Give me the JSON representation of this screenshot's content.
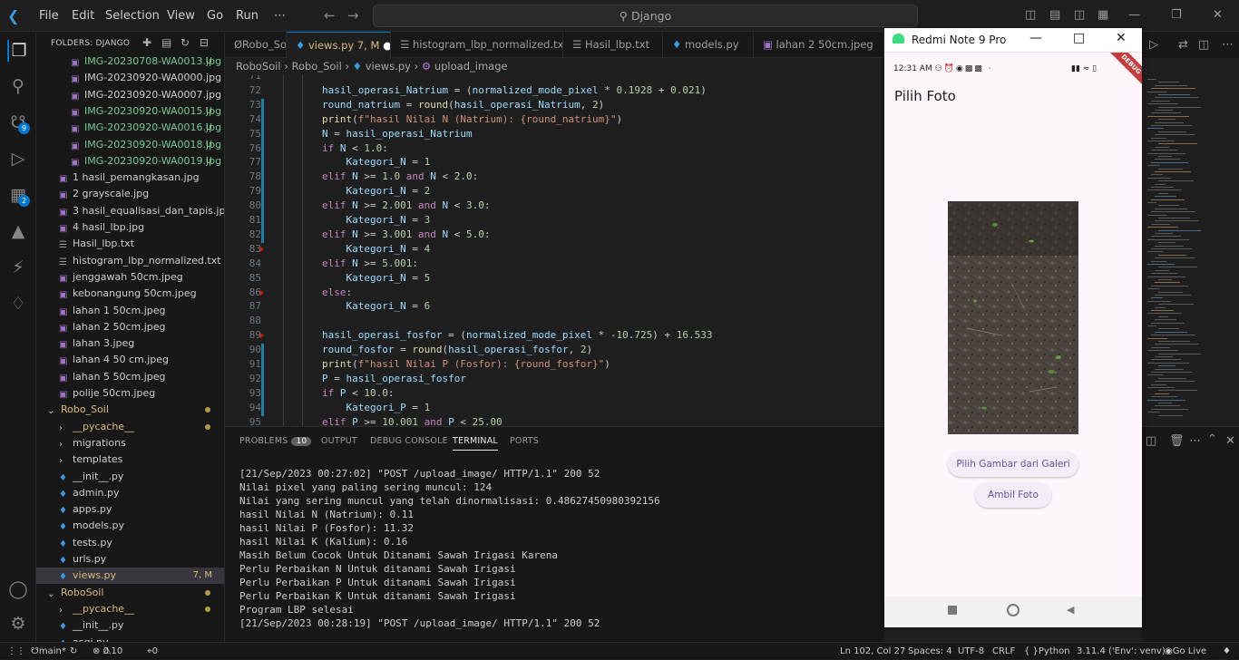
{
  "title_bar": {
    "menus": [
      "File",
      "Edit",
      "Selection",
      "View",
      "Go",
      "Run",
      "⋯"
    ],
    "search": "Django"
  },
  "activity_badges": {
    "source_control": "9",
    "extensions": "2"
  },
  "explorer": {
    "header": "FOLDERS: DJANGO",
    "items": [
      {
        "label": "IMG-20230708-WA0013.jpg",
        "status": "U",
        "indent": 2,
        "type": "image",
        "color": "#73c991"
      },
      {
        "label": "IMG-20230920-WA0000.jpg",
        "status": "",
        "indent": 2,
        "type": "image",
        "color": "#cccccc"
      },
      {
        "label": "IMG-20230920-WA0007.jpg",
        "status": "",
        "indent": 2,
        "type": "image",
        "color": "#cccccc"
      },
      {
        "label": "IMG-20230920-WA0015.jpg",
        "status": "U",
        "indent": 2,
        "type": "image",
        "color": "#73c991"
      },
      {
        "label": "IMG-20230920-WA0016.jpg",
        "status": "U",
        "indent": 2,
        "type": "image",
        "color": "#73c991"
      },
      {
        "label": "IMG-20230920-WA0018.jpg",
        "status": "U",
        "indent": 2,
        "type": "image",
        "color": "#73c991"
      },
      {
        "label": "IMG-20230920-WA0019.jpg",
        "status": "U",
        "indent": 2,
        "type": "image",
        "color": "#73c991"
      },
      {
        "label": "1 hasil_pemangkasan.jpg",
        "status": "",
        "indent": 1,
        "type": "image",
        "color": "#cccccc"
      },
      {
        "label": "2 grayscale.jpg",
        "status": "",
        "indent": 1,
        "type": "image",
        "color": "#cccccc"
      },
      {
        "label": "3 hasil_equalisasi_dan_tapis.jpg",
        "status": "",
        "indent": 1,
        "type": "image",
        "color": "#cccccc"
      },
      {
        "label": "4 hasil_lbp.jpg",
        "status": "",
        "indent": 1,
        "type": "image",
        "color": "#cccccc"
      },
      {
        "label": "Hasil_lbp.txt",
        "status": "",
        "indent": 1,
        "type": "text",
        "color": "#cccccc"
      },
      {
        "label": "histogram_lbp_normalized.txt",
        "status": "",
        "indent": 1,
        "type": "text",
        "color": "#cccccc"
      },
      {
        "label": "jenggawah 50cm.jpeg",
        "status": "",
        "indent": 1,
        "type": "image",
        "color": "#cccccc"
      },
      {
        "label": "kebonangung 50cm.jpeg",
        "status": "",
        "indent": 1,
        "type": "image",
        "color": "#cccccc"
      },
      {
        "label": "lahan 1 50cm.jpeg",
        "status": "",
        "indent": 1,
        "type": "image",
        "color": "#cccccc"
      },
      {
        "label": "lahan 2 50cm.jpeg",
        "status": "",
        "indent": 1,
        "type": "image",
        "color": "#cccccc"
      },
      {
        "label": "lahan 3.jpeg",
        "status": "",
        "indent": 1,
        "type": "image",
        "color": "#cccccc"
      },
      {
        "label": "lahan 4 50 cm.jpeg",
        "status": "",
        "indent": 1,
        "type": "image",
        "color": "#cccccc"
      },
      {
        "label": "lahan 5 50cm.jpeg",
        "status": "",
        "indent": 1,
        "type": "image",
        "color": "#cccccc"
      },
      {
        "label": "polije 50cm.jpeg",
        "status": "",
        "indent": 1,
        "type": "image",
        "color": "#cccccc"
      },
      {
        "label": "Robo_Soil",
        "status": "dot",
        "indent": 0,
        "type": "folder-open",
        "color": "#d7ba7d"
      },
      {
        "label": "__pycache__",
        "status": "dot",
        "indent": 1,
        "type": "folder",
        "color": "#d7ba7d"
      },
      {
        "label": "migrations",
        "status": "",
        "indent": 1,
        "type": "folder",
        "color": "#cccccc"
      },
      {
        "label": "templates",
        "status": "",
        "indent": 1,
        "type": "folder",
        "color": "#cccccc"
      },
      {
        "label": "__init__.py",
        "status": "",
        "indent": 1,
        "type": "python",
        "color": "#cccccc"
      },
      {
        "label": "admin.py",
        "status": "",
        "indent": 1,
        "type": "python",
        "color": "#cccccc"
      },
      {
        "label": "apps.py",
        "status": "",
        "indent": 1,
        "type": "python",
        "color": "#cccccc"
      },
      {
        "label": "models.py",
        "status": "",
        "indent": 1,
        "type": "python",
        "color": "#cccccc"
      },
      {
        "label": "tests.py",
        "status": "",
        "indent": 1,
        "type": "python",
        "color": "#cccccc"
      },
      {
        "label": "urls.py",
        "status": "",
        "indent": 1,
        "type": "python",
        "color": "#cccccc"
      },
      {
        "label": "views.py",
        "status": "7, M",
        "indent": 1,
        "type": "python",
        "color": "#d7ba7d"
      },
      {
        "label": "RoboSoil",
        "status": "dot",
        "indent": 0,
        "type": "folder-open",
        "color": "#d7ba7d"
      },
      {
        "label": "__pycache__",
        "status": "dot",
        "indent": 1,
        "type": "folder",
        "color": "#d7ba7d"
      },
      {
        "label": "__init__.py",
        "status": "",
        "indent": 1,
        "type": "python",
        "color": "#cccccc"
      },
      {
        "label": "asgi.py",
        "status": "",
        "indent": 1,
        "type": "python",
        "color": "#cccccc"
      }
    ]
  },
  "tabs": [
    {
      "label": "ØRobo_Soil",
      "active": false
    },
    {
      "label": "views.py",
      "suffix": "7, M",
      "active": true
    },
    {
      "label": "histogram_lbp_normalized.txt",
      "active": false
    },
    {
      "label": "Hasil_lbp.txt",
      "active": false
    },
    {
      "label": "models.py",
      "active": false
    },
    {
      "label": "lahan 2 50cm.jpeg",
      "active": false
    }
  ],
  "breadcrumb": {
    "parts": [
      "RoboSoil",
      "Robo_Soil",
      "views.py",
      "upload_image"
    ]
  },
  "editor": {
    "lines": [
      {
        "n": 71,
        "code": ""
      },
      {
        "n": 72,
        "code": "hasil_operasi_Natrium = (normalized_mode_pixel * 0.1928 + 0.021)"
      },
      {
        "n": 73,
        "code": "round_natrium = round(hasil_operasi_Natrium, 2)"
      },
      {
        "n": 74,
        "code": "print(f\"hasil Nilai N (Natrium): {round_natrium}\")"
      },
      {
        "n": 75,
        "code": "N = hasil_operasi_Natrium"
      },
      {
        "n": 76,
        "code": "if N < 1.0:"
      },
      {
        "n": 77,
        "code": "    Kategori_N = 1"
      },
      {
        "n": 78,
        "code": "elif N >= 1.0 and N < 2.0:"
      },
      {
        "n": 79,
        "code": "    Kategori_N = 2"
      },
      {
        "n": 80,
        "code": "elif N >= 2.001 and N < 3.0:"
      },
      {
        "n": 81,
        "code": "    Kategori_N = 3"
      },
      {
        "n": 82,
        "code": "elif N >= 3.001 and N < 5.0:"
      },
      {
        "n": 83,
        "code": "    Kategori_N = 4"
      },
      {
        "n": 84,
        "code": "elif N >= 5.001:"
      },
      {
        "n": 85,
        "code": "    Kategori_N = 5"
      },
      {
        "n": 86,
        "code": "else:"
      },
      {
        "n": 87,
        "code": "    Kategori_N = 6"
      },
      {
        "n": 88,
        "code": ""
      },
      {
        "n": 89,
        "code": "hasil_operasi_fosfor = (normalized_mode_pixel * -10.725) + 16.533"
      },
      {
        "n": 90,
        "code": "round_fosfor = round(hasil_operasi_fosfor, 2)"
      },
      {
        "n": 91,
        "code": "print(f\"hasil Nilai P (Fosfor): {round_fosfor}\")"
      },
      {
        "n": 92,
        "code": "P = hasil_operasi_fosfor"
      },
      {
        "n": 93,
        "code": "if P < 10.0:"
      },
      {
        "n": 94,
        "code": "    Kategori_P = 1"
      },
      {
        "n": 95,
        "code": "elif P >= 10.001 and P < 25.00"
      }
    ]
  },
  "panel": {
    "tabs": [
      "PROBLEMS",
      "OUTPUT",
      "DEBUG CONSOLE",
      "TERMINAL",
      "PORTS"
    ],
    "problems_count": "10",
    "terminal_lines": [
      "[21/Sep/2023 00:27:02] \"POST /upload_image/ HTTP/1.1\" 200 52",
      "Nilai pixel yang paling sering muncul: 124",
      "Nilai yang sering muncul yang telah dinormalisasi: 0.48627450980392156",
      "hasil Nilai N (Natrium): 0.11",
      "hasil Nilai P (Fosfor): 11.32",
      "hasil Nilai K (Kalium): 0.16",
      "Masih Belum Cocok Untuk Ditanami Sawah Irigasi Karena",
      "Perlu Perbaikan N Untuk ditanami Sawah Irigasi",
      "Perlu Perbaikan P Untuk ditanami Sawah Irigasi",
      "Perlu Perbaikan K Untuk ditanami Sawah Irigasi",
      "Program LBP selesai",
      "[21/Sep/2023 00:28:19] \"POST /upload_image/ HTTP/1.1\" 200 52"
    ]
  },
  "status_bar": {
    "branch": "main*",
    "errors": "0",
    "warnings": "10",
    "ports": "0",
    "position": "Ln 102, Col 27",
    "spaces": "Spaces: 4",
    "encoding": "UTF-8",
    "eol": "CRLF",
    "language": "Python",
    "interpreter": "3.11.4 ('Env': venv)",
    "live": "Go Live"
  },
  "emulator": {
    "window_title": "Redmi Note 9 Pro",
    "time": "12:31 AM",
    "debug_banner": "DEBUG",
    "app_title": "Pilih Foto",
    "gallery_button": "Pilih Gambar dari Galeri",
    "camera_button": "Ambil Foto"
  },
  "colors": {
    "accent": "#0078d4",
    "added": "#73c991",
    "modified": "#d7ba7d",
    "button_text": "#6750a4"
  }
}
